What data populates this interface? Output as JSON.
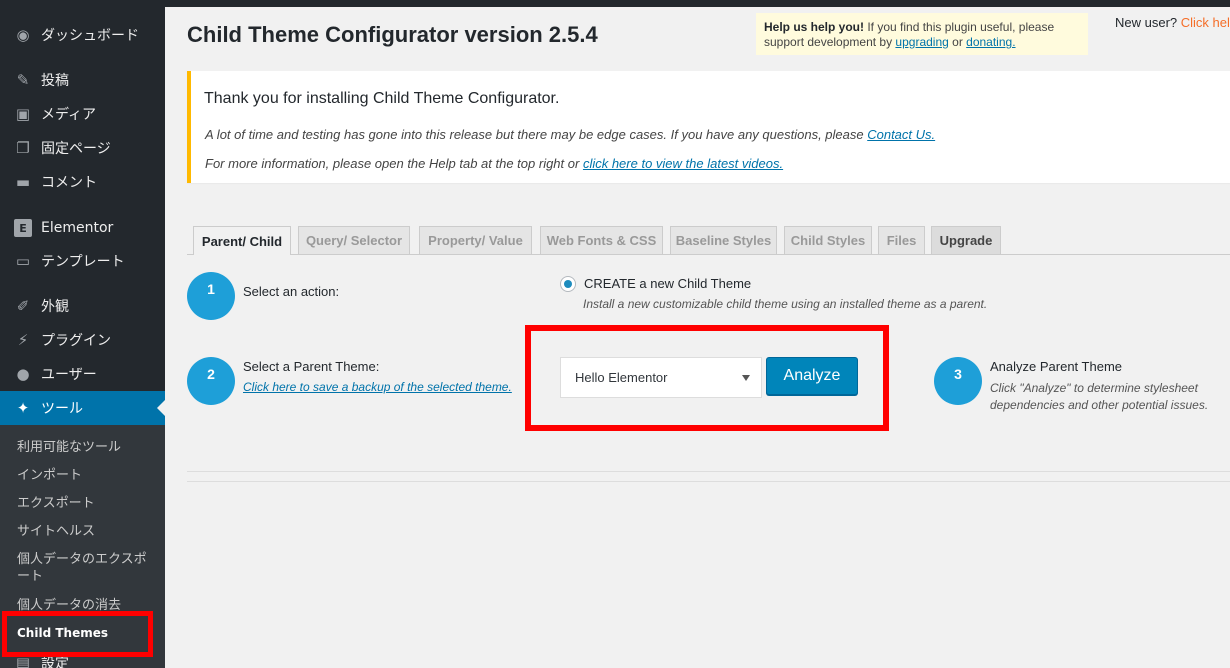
{
  "sidebar": {
    "items": [
      {
        "label": "ダッシュボード",
        "icon": "dashboard-icon",
        "glyph": "◉"
      },
      {
        "label": "投稿",
        "icon": "pin-icon",
        "glyph": "✎"
      },
      {
        "label": "メディア",
        "icon": "media-icon",
        "glyph": "▣"
      },
      {
        "label": "固定ページ",
        "icon": "pages-icon",
        "glyph": "❐"
      },
      {
        "label": "コメント",
        "icon": "comment-icon",
        "glyph": "▬"
      },
      {
        "label": "Elementor",
        "icon": "elementor-icon",
        "glyph": "E"
      },
      {
        "label": "テンプレート",
        "icon": "folder-icon",
        "glyph": "▭"
      },
      {
        "label": "外観",
        "icon": "brush-icon",
        "glyph": "✐"
      },
      {
        "label": "プラグイン",
        "icon": "plugin-icon",
        "glyph": "⚡"
      },
      {
        "label": "ユーザー",
        "icon": "user-icon",
        "glyph": "●"
      },
      {
        "label": "ツール",
        "icon": "wrench-icon",
        "glyph": "✦"
      }
    ],
    "submenu": [
      "利用可能なツール",
      "インポート",
      "エクスポート",
      "サイトヘルス",
      "個人データのエクスポート",
      "個人データの消去",
      "Child Themes"
    ],
    "next_item_label": "設定"
  },
  "header": {
    "title": "Child Theme Configurator version 2.5.4",
    "help_strong": "Help us help you!",
    "help_text_1": " If you find this plugin useful, please support development by ",
    "help_link_1": "upgrading",
    "help_text_2": " or ",
    "help_link_2": "donating.",
    "new_user_text": "New user? ",
    "new_user_link": "Click help"
  },
  "notice": {
    "title": "Thank you for installing Child Theme Configurator.",
    "line1_text": "A lot of time and testing has gone into this release but there may be edge cases. If you have any questions, please ",
    "line1_link": "Contact Us.",
    "line2_text": "For more information, please open the Help tab at the top right or ",
    "line2_link": "click here to view the latest videos."
  },
  "tabs": [
    "Parent/ Child",
    "Query/ Selector",
    "Property/ Value",
    "Web Fonts & CSS",
    "Baseline Styles",
    "Child Styles",
    "Files",
    "Upgrade"
  ],
  "steps": {
    "step1": {
      "number": "1",
      "label": "Select an action:",
      "option_label": "CREATE a new Child Theme",
      "option_desc": "Install a new customizable child theme using an installed theme as a parent."
    },
    "step2": {
      "number": "2",
      "label": "Select a Parent Theme:",
      "link": "Click here to save a backup of the selected theme.",
      "selected_theme": "Hello Elementor",
      "button": "Analyze"
    },
    "step3": {
      "number": "3",
      "label": "Analyze Parent Theme",
      "desc_1": "Click \"Analyze\" to determine stylesheet",
      "desc_2": "dependencies and other potential issues."
    }
  },
  "colors": {
    "sidebar_bg": "#23282d",
    "active_blue": "#0073aa",
    "step_circle": "#1e9fd8",
    "button_blue": "#0085ba",
    "notice_border": "#ffb900",
    "highlight_red": "#ff0000"
  }
}
